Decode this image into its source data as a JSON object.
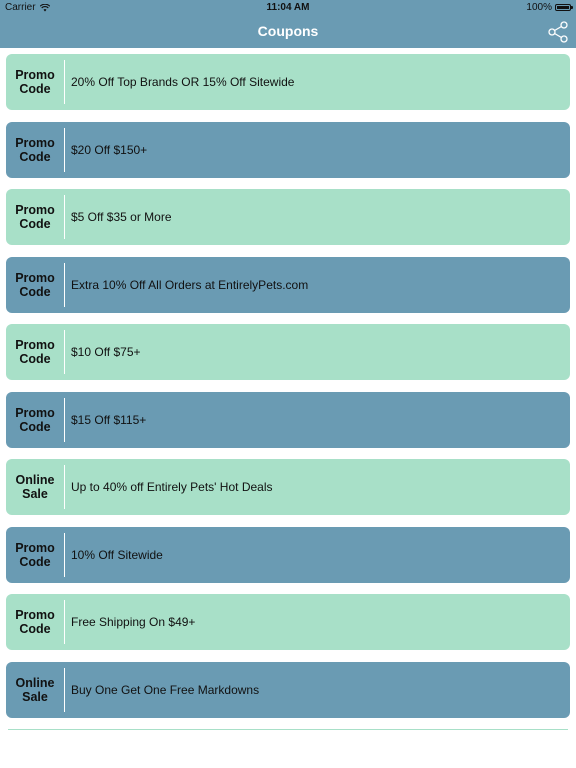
{
  "status_bar": {
    "carrier": "Carrier",
    "time": "11:04 AM",
    "battery": "100%"
  },
  "nav": {
    "title": "Coupons",
    "share_icon": "share-icon"
  },
  "colors": {
    "accent": "#6a9bb3",
    "green": "#a8e0c8",
    "text": "#111111",
    "title": "#ffffff"
  },
  "coupons": [
    {
      "type": "Promo\nCode",
      "description": "20% Off Top Brands OR 15% Off Sitewide",
      "style": "green"
    },
    {
      "type": "Promo\nCode",
      "description": "$20 Off $150+",
      "style": "blue"
    },
    {
      "type": "Promo\nCode",
      "description": "$5 Off $35 or More",
      "style": "green"
    },
    {
      "type": "Promo\nCode",
      "description": "Extra 10% Off All Orders at EntirelyPets.com",
      "style": "blue"
    },
    {
      "type": "Promo\nCode",
      "description": "$10 Off $75+",
      "style": "green"
    },
    {
      "type": "Promo\nCode",
      "description": "$15 Off $115+",
      "style": "blue"
    },
    {
      "type": "Online\nSale",
      "description": "Up to 40% off Entirely Pets' Hot Deals",
      "style": "green"
    },
    {
      "type": "Promo\nCode",
      "description": "10% Off Sitewide",
      "style": "blue"
    },
    {
      "type": "Promo\nCode",
      "description": "Free Shipping On $49+",
      "style": "green"
    },
    {
      "type": "Online\nSale",
      "description": "Buy One Get One Free Markdowns",
      "style": "blue"
    }
  ]
}
